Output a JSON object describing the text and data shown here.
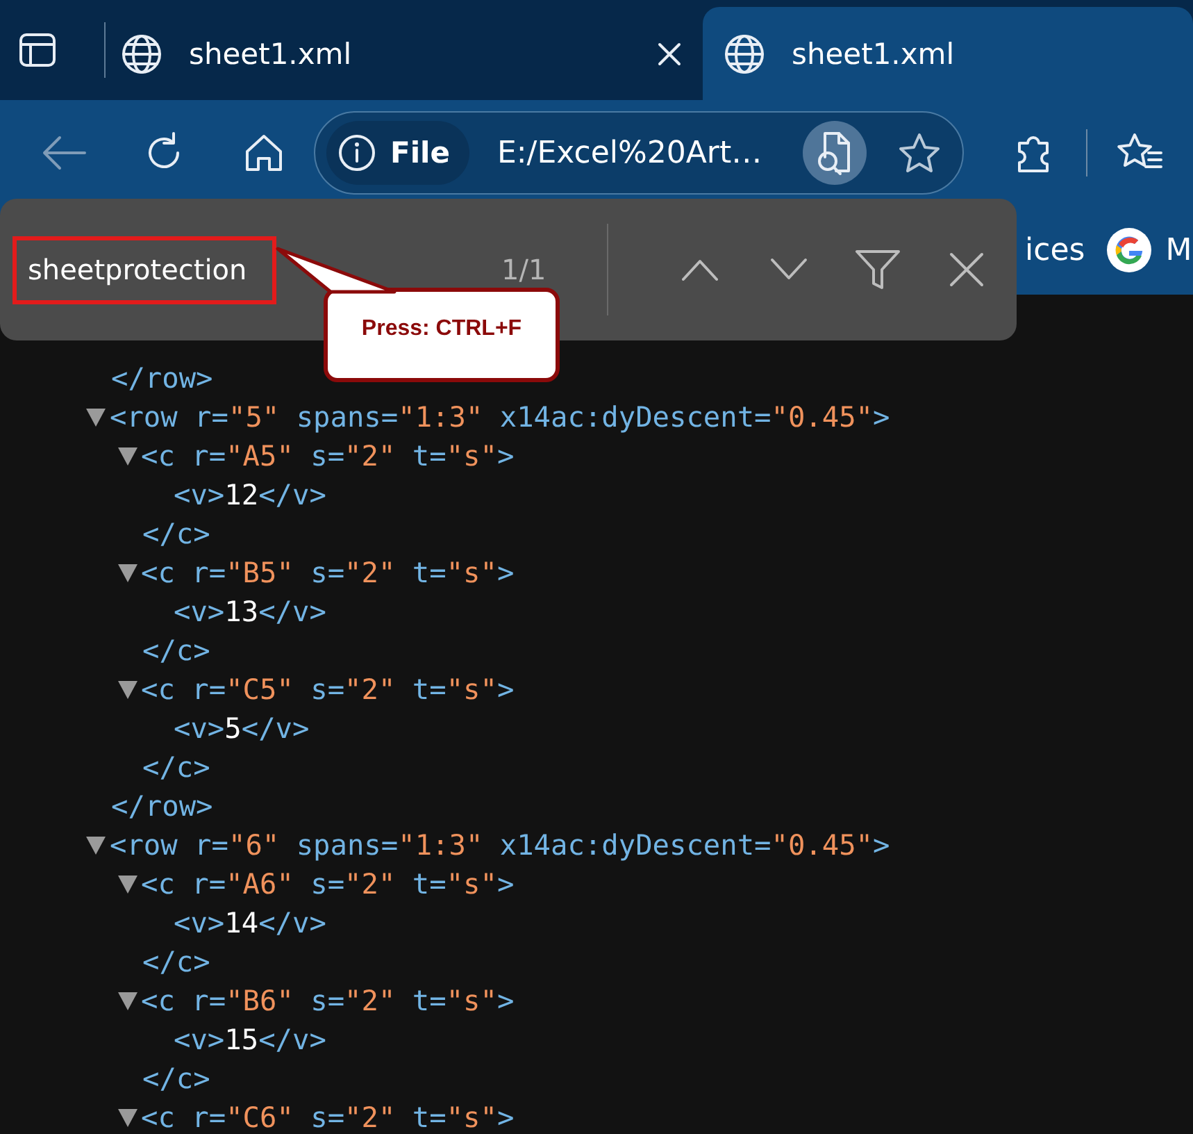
{
  "tabs": [
    {
      "title": "sheet1.xml",
      "selected": false,
      "close_button": true
    },
    {
      "title": "sheet1.xml",
      "selected": true,
      "close_button": false
    }
  ],
  "toolbar": {
    "back_button": {
      "disabled": true
    },
    "site_chip": "File",
    "url": "E:/Excel%20Art…"
  },
  "bookmarks": [
    {
      "kind": "text",
      "label": "ices"
    },
    {
      "kind": "google",
      "label": "M"
    }
  ],
  "find_bar": {
    "query": "sheetprotection",
    "query_outlined": true,
    "match_count": "1/1"
  },
  "callout": {
    "text": "Press: CTRL+F"
  },
  "xml": [
    {
      "close": "</row>"
    },
    {
      "open": [
        {
          "kind": "markup",
          "text": "<row r="
        },
        {
          "kind": "value",
          "text": "\"5\""
        },
        {
          "kind": "markup",
          "text": " spans="
        },
        {
          "kind": "value",
          "text": "\"1:3\""
        },
        {
          "kind": "markup",
          "text": " x14ac:dyDescent="
        },
        {
          "kind": "value",
          "text": "\"0.45\""
        },
        {
          "kind": "markup",
          "text": ">"
        }
      ],
      "expanded": true,
      "children": [
        {
          "open": [
            {
              "kind": "markup",
              "text": "<c r="
            },
            {
              "kind": "value",
              "text": "\"A5\""
            },
            {
              "kind": "markup",
              "text": " s="
            },
            {
              "kind": "value",
              "text": "\"2\""
            },
            {
              "kind": "markup",
              "text": " t="
            },
            {
              "kind": "value",
              "text": "\"s\""
            },
            {
              "kind": "markup",
              "text": ">"
            }
          ],
          "expanded": true,
          "children": [
            {
              "line": [
                {
                  "kind": "markup",
                  "text": "<v>"
                },
                {
                  "kind": "text",
                  "text": "12"
                },
                {
                  "kind": "markup",
                  "text": "</v>"
                }
              ]
            }
          ],
          "close": "</c>"
        },
        {
          "open": [
            {
              "kind": "markup",
              "text": "<c r="
            },
            {
              "kind": "value",
              "text": "\"B5\""
            },
            {
              "kind": "markup",
              "text": " s="
            },
            {
              "kind": "value",
              "text": "\"2\""
            },
            {
              "kind": "markup",
              "text": " t="
            },
            {
              "kind": "value",
              "text": "\"s\""
            },
            {
              "kind": "markup",
              "text": ">"
            }
          ],
          "expanded": true,
          "children": [
            {
              "line": [
                {
                  "kind": "markup",
                  "text": "<v>"
                },
                {
                  "kind": "text",
                  "text": "13"
                },
                {
                  "kind": "markup",
                  "text": "</v>"
                }
              ]
            }
          ],
          "close": "</c>"
        },
        {
          "open": [
            {
              "kind": "markup",
              "text": "<c r="
            },
            {
              "kind": "value",
              "text": "\"C5\""
            },
            {
              "kind": "markup",
              "text": " s="
            },
            {
              "kind": "value",
              "text": "\"2\""
            },
            {
              "kind": "markup",
              "text": " t="
            },
            {
              "kind": "value",
              "text": "\"s\""
            },
            {
              "kind": "markup",
              "text": ">"
            }
          ],
          "expanded": true,
          "children": [
            {
              "line": [
                {
                  "kind": "markup",
                  "text": "<v>"
                },
                {
                  "kind": "text",
                  "text": "5"
                },
                {
                  "kind": "markup",
                  "text": "</v>"
                }
              ]
            }
          ],
          "close": "</c>"
        }
      ],
      "close": "</row>"
    },
    {
      "open": [
        {
          "kind": "markup",
          "text": "<row r="
        },
        {
          "kind": "value",
          "text": "\"6\""
        },
        {
          "kind": "markup",
          "text": " spans="
        },
        {
          "kind": "value",
          "text": "\"1:3\""
        },
        {
          "kind": "markup",
          "text": " x14ac:dyDescent="
        },
        {
          "kind": "value",
          "text": "\"0.45\""
        },
        {
          "kind": "markup",
          "text": ">"
        }
      ],
      "expanded": true,
      "children": [
        {
          "open": [
            {
              "kind": "markup",
              "text": "<c r="
            },
            {
              "kind": "value",
              "text": "\"A6\""
            },
            {
              "kind": "markup",
              "text": " s="
            },
            {
              "kind": "value",
              "text": "\"2\""
            },
            {
              "kind": "markup",
              "text": " t="
            },
            {
              "kind": "value",
              "text": "\"s\""
            },
            {
              "kind": "markup",
              "text": ">"
            }
          ],
          "expanded": true,
          "children": [
            {
              "line": [
                {
                  "kind": "markup",
                  "text": "<v>"
                },
                {
                  "kind": "text",
                  "text": "14"
                },
                {
                  "kind": "markup",
                  "text": "</v>"
                }
              ]
            }
          ],
          "close": "</c>"
        },
        {
          "open": [
            {
              "kind": "markup",
              "text": "<c r="
            },
            {
              "kind": "value",
              "text": "\"B6\""
            },
            {
              "kind": "markup",
              "text": " s="
            },
            {
              "kind": "value",
              "text": "\"2\""
            },
            {
              "kind": "markup",
              "text": " t="
            },
            {
              "kind": "value",
              "text": "\"s\""
            },
            {
              "kind": "markup",
              "text": ">"
            }
          ],
          "expanded": true,
          "children": [
            {
              "line": [
                {
                  "kind": "markup",
                  "text": "<v>"
                },
                {
                  "kind": "text",
                  "text": "15"
                },
                {
                  "kind": "markup",
                  "text": "</v>"
                }
              ]
            }
          ],
          "close": "</c>"
        },
        {
          "open": [
            {
              "kind": "markup",
              "text": "<c r="
            },
            {
              "kind": "value",
              "text": "\"C6\""
            },
            {
              "kind": "markup",
              "text": " s="
            },
            {
              "kind": "value",
              "text": "\"2\""
            },
            {
              "kind": "markup",
              "text": " t="
            },
            {
              "kind": "value",
              "text": "\"s\""
            },
            {
              "kind": "markup",
              "text": ">"
            }
          ],
          "expanded": true
        }
      ]
    }
  ]
}
